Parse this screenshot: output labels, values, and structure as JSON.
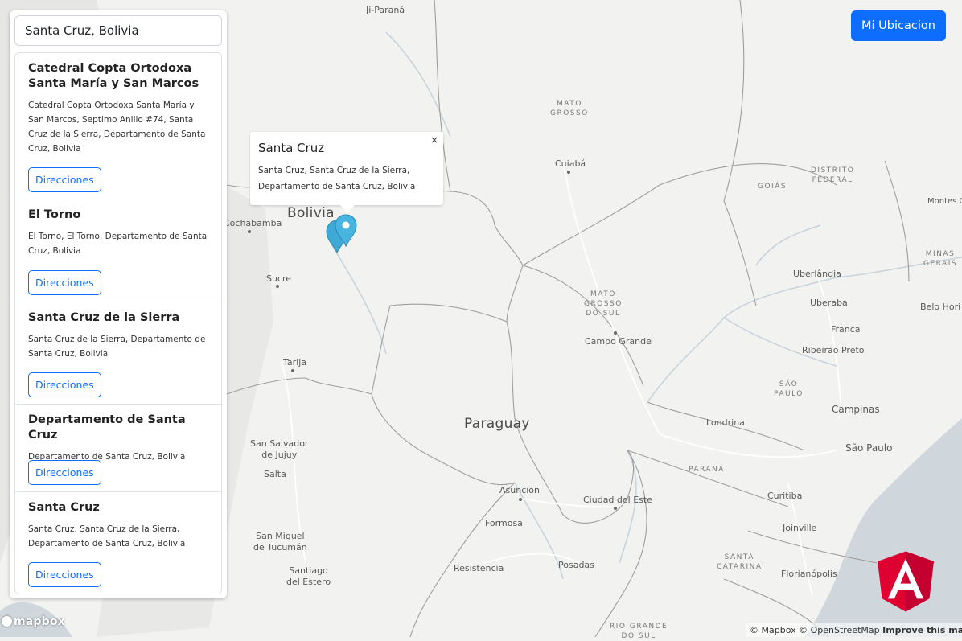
{
  "search": {
    "value": "Santa Cruz, Bolivia"
  },
  "locate_button": {
    "label": "Mi Ubicacion"
  },
  "results": [
    {
      "title": "Catedral Copta Ortodoxa Santa María y San Marcos",
      "address": "Catedral Copta Ortodoxa Santa María y San Marcos, Septimo Anillo #74, Santa Cruz de la Sierra, Departamento de Santa Cruz, Bolivia",
      "button": "Direcciones"
    },
    {
      "title": "El Torno",
      "address": "El Torno, El Torno, Departamento de Santa Cruz, Bolivia",
      "button": "Direcciones"
    },
    {
      "title": "Santa Cruz de la Sierra",
      "address": "Santa Cruz de la Sierra, Departamento de Santa Cruz, Bolivia",
      "button": "Direcciones"
    },
    {
      "title": "Departamento de Santa Cruz",
      "address": "Departamento de Santa Cruz, Bolivia",
      "button": "Direcciones"
    },
    {
      "title": "Santa Cruz",
      "address": "Santa Cruz, Santa Cruz de la Sierra, Departamento de Santa Cruz, Bolivia",
      "button": "Direcciones"
    }
  ],
  "popup": {
    "title": "Santa Cruz",
    "text": "Santa Cruz, Santa Cruz de la Sierra, Departamento de Santa Cruz, Bolivia",
    "close": "×"
  },
  "map": {
    "countries": {
      "bolivia": "Bolivia",
      "paraguay": "Paraguay"
    },
    "regions": {
      "mato_grosso": "MATO\nGROSSO",
      "mato_grosso_do_sul": "MATO\nGROSSO\nDO SUL",
      "goias": "GOIÁS",
      "distrito_federal": "DISTRITO\nFEDERAL",
      "minas_gerais": "MINAS\nGERAIS",
      "sao_paulo": "SÃO\nPAULO",
      "parana": "PARANÁ",
      "santa_catarina": "SANTA\nCATARINA",
      "rio_grande": "RIO GRANDE\nDO SUL"
    },
    "cities": {
      "ji_parana": "Ji-Paraná",
      "cuiaba": "Cuiabá",
      "cochabamba": "Cochabamba",
      "sucre": "Sucre",
      "tarija": "Tarija",
      "montes_claros": "Montes C",
      "uberlandia": "Uberlândia",
      "uberaba": "Uberaba",
      "belo_horizonte": "Belo Hori",
      "franca": "Franca",
      "ribeirao_preto": "Ribeirão Preto",
      "campo_grande": "Campo Grande",
      "campinas": "Campinas",
      "sao_paulo": "São Paulo",
      "londrina": "Londrina",
      "san_salvador": "San Salvador\nde Jujuy",
      "salta": "Salta",
      "asuncion": "Asunción",
      "ciudad_del_este": "Ciudad del Este",
      "formosa": "Formosa",
      "curitiba": "Curitiba",
      "joinville": "Joinville",
      "san_miguel": "San Miguel\nde Tucumán",
      "resistencia": "Resistencia",
      "posadas": "Posadas",
      "florianopolis": "Florianópolis",
      "santiago": "Santiago\ndel Estero"
    }
  },
  "footer": {
    "mapbox_logo": "mapbox",
    "attribution_mapbox": "© Mapbox",
    "attribution_osm": "© OpenStreetMap",
    "improve": "Improve this map"
  },
  "colors": {
    "land": "#f2f2f0",
    "water": "#cfd6dc",
    "border": "#9c9c9c",
    "road": "#ffffff",
    "river": "#c9d3db",
    "primary": "#0d6efd",
    "marker": "#3fa9d6",
    "angular_red": "#dd0031"
  }
}
